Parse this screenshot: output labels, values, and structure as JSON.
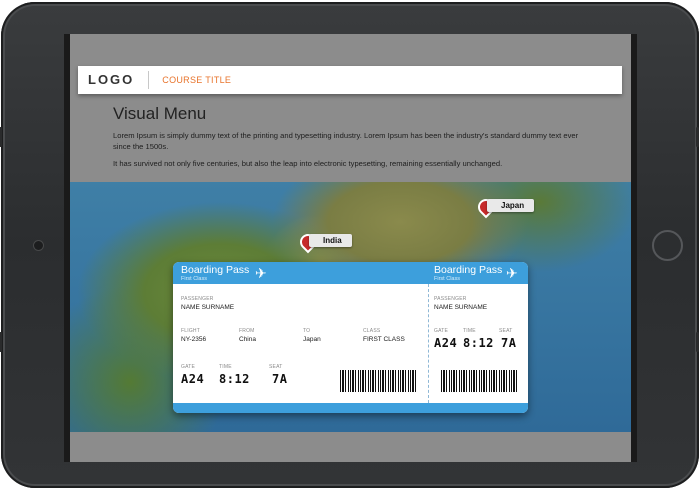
{
  "header": {
    "logo": "LOGO",
    "course_title": "COURSE TITLE"
  },
  "intro": {
    "heading": "Visual Menu",
    "paragraphs": [
      "Lorem Ipsum is simply dummy text of the printing and typesetting industry. Lorem Ipsum has been the industry's standard dummy text ever since the 1500s.",
      "It has survived not only five centuries, but also the leap into electronic typesetting, remaining essentially unchanged."
    ]
  },
  "map": {
    "pins": [
      {
        "label": "India"
      },
      {
        "label": "Japan"
      }
    ]
  },
  "boarding_pass": {
    "main": {
      "title": "Boarding Pass",
      "class_sub": "First Class",
      "passenger_label": "PASSENGER",
      "passenger_value": "NAME SURNAME",
      "flight_label": "FLIGHT",
      "flight_value": "NY-2356",
      "from_label": "FROM",
      "from_value": "China",
      "to_label": "TO",
      "to_value": "Japan",
      "class_label": "CLASS",
      "class_value": "FIRST CLASS",
      "gate_label": "GATE",
      "gate_value": "A24",
      "time_label": "TIME",
      "time_value": "8:12",
      "seat_label": "SEAT",
      "seat_value": "7A"
    },
    "stub": {
      "title": "Boarding Pass",
      "class_sub": "First Class",
      "passenger_label": "PASSENGER",
      "passenger_value": "NAME SURNAME",
      "gate_label": "GATE",
      "gate_value": "A24",
      "time_label": "TIME",
      "time_value": "8:12",
      "seat_label": "SEAT",
      "seat_value": "7A"
    }
  },
  "colors": {
    "accent": "#3d9fdc",
    "course_title": "#e8742c",
    "pin": "#c62a2a"
  },
  "icons": {
    "plane": "airplane-icon",
    "pin": "map-pin-icon"
  }
}
